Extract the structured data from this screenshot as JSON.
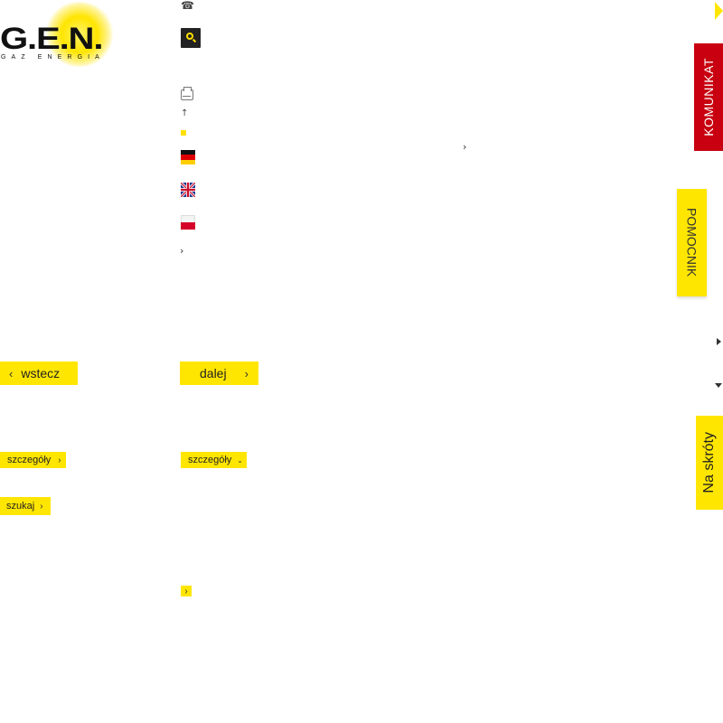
{
  "logo": {
    "wordmark": "G.E.N.",
    "tagline": "GAZ ENERGIA"
  },
  "icons": {
    "phone": "☎",
    "up": "↑",
    "chevron_right": "›",
    "chevron_down": "⌄"
  },
  "nav": {
    "back_label": "wstecz",
    "next_label": "dalej"
  },
  "buttons": {
    "details_label": "szczegóły",
    "details_label_2": "szczegóły",
    "search_label": "szukaj"
  },
  "side_tabs": {
    "komunikat": "KOMUNIKAT",
    "pomocnik": "POMOCNIK",
    "na_skroty": "Na skróty"
  },
  "colors": {
    "brand_yellow": "#ffe600",
    "alert_red": "#c8000f",
    "dark": "#222222"
  }
}
